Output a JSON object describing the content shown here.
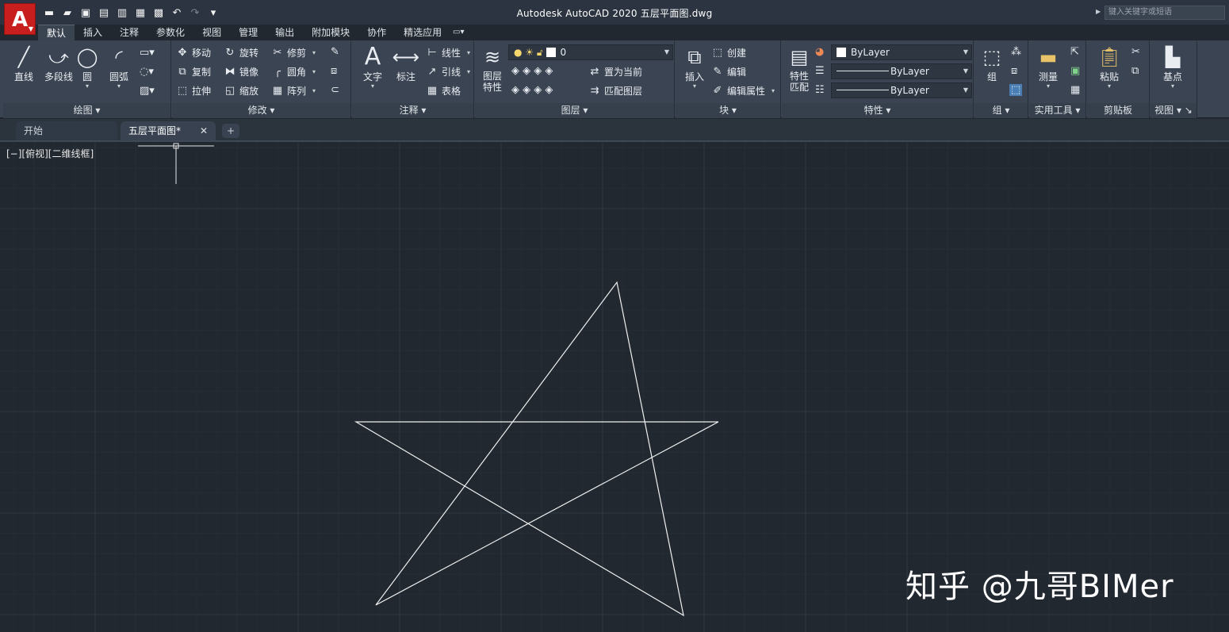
{
  "title_bar": {
    "app_logo": "A",
    "title": "Autodesk AutoCAD 2020    五层平面图.dwg",
    "search_placeholder": "键入关键字或短语",
    "quick_access_icons": [
      "new-icon",
      "open-icon",
      "save-icon",
      "save-as-icon",
      "open-web-icon",
      "save-web-icon",
      "print-icon",
      "undo-icon",
      "redo-icon",
      "customize-icon"
    ]
  },
  "ribbon_tabs": [
    "默认",
    "插入",
    "注释",
    "参数化",
    "视图",
    "管理",
    "输出",
    "附加模块",
    "协作",
    "精选应用"
  ],
  "ribbon": {
    "draw": {
      "title": "绘图",
      "line": "直线",
      "polyline": "多段线",
      "circle": "圆",
      "arc": "圆弧"
    },
    "modify": {
      "title": "修改",
      "move": "移动",
      "rotate": "旋转",
      "trim": "修剪",
      "copy": "复制",
      "mirror": "镜像",
      "fillet": "圆角",
      "stretch": "拉伸",
      "scale": "缩放",
      "array": "阵列"
    },
    "annotation": {
      "title": "注释",
      "text": "文字",
      "dimension": "标注",
      "linear": "线性",
      "leader": "引线",
      "table": "表格"
    },
    "layers": {
      "title": "图层",
      "layer_properties_1": "图层",
      "layer_properties_2": "特性",
      "current_layer": "0",
      "set_current": "置为当前",
      "match_layer": "匹配图层"
    },
    "block": {
      "title": "块",
      "insert": "插入",
      "create": "创建",
      "edit": "编辑",
      "edit_attributes": "编辑属性"
    },
    "properties": {
      "title": "特性",
      "match_1": "特性",
      "match_2": "匹配",
      "color": "ByLayer",
      "linetype": "ByLayer",
      "lineweight": "ByLayer"
    },
    "groups": {
      "title": "组",
      "group": "组"
    },
    "utilities": {
      "title": "实用工具",
      "measure": "测量"
    },
    "clipboard": {
      "title": "剪贴板",
      "paste": "粘贴"
    },
    "view": {
      "title": "视图",
      "base": "基点"
    }
  },
  "doc_tabs": {
    "start": "开始",
    "file": "五层平面图*",
    "close": "✕",
    "add": "+"
  },
  "canvas": {
    "viewport_label": "[−][俯视][二维线框]",
    "watermark": "知乎 @九哥BIMer"
  }
}
